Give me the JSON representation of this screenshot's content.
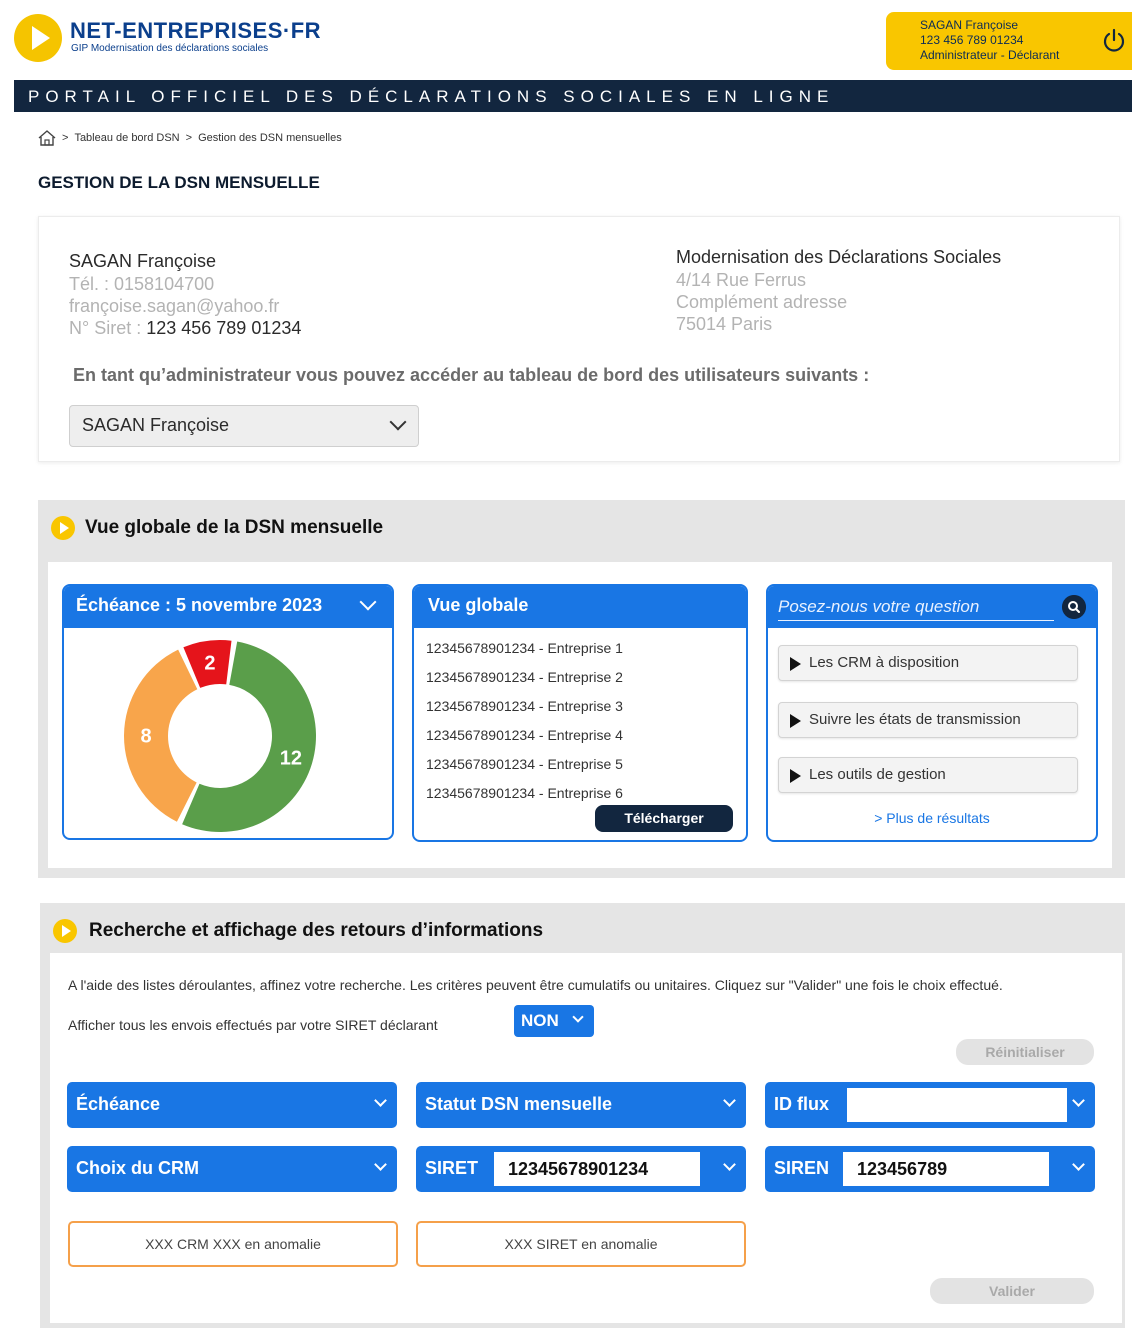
{
  "header": {
    "brand": "NET-ENTREPRISES·FR",
    "brand_sub": "GIP Modernisation des déclarations sociales",
    "user_name": "SAGAN Françoise",
    "user_siret": "123 456 789 01234",
    "user_role": "Administrateur - Déclarant",
    "logout_icon": "power-icon",
    "banner": "PORTAIL OFFICIEL DES DÉCLARATIONS SOCIALES EN LIGNE",
    "brand_color": "#0b3f8c",
    "accent_color": "#f9c600",
    "banner_color": "#12263f"
  },
  "breadcrumb": {
    "home_icon": "home-icon",
    "items": [
      "Tableau de bord DSN",
      "Gestion des DSN mensuelles"
    ],
    "separator": ">"
  },
  "page_title": "GESTION DE LA DSN MENSUELLE",
  "profile": {
    "name": "SAGAN Françoise",
    "phone": "Tél. : 0158104700",
    "email": "françoise.sagan@yahoo.fr",
    "siret_label": "N° Siret : ",
    "siret_value": "123 456 789 01234",
    "org_name": "Modernisation des Déclarations Sociales",
    "address_1": "4/14 Rue Ferrus",
    "address_2": "Complément adresse",
    "address_3": "75014 Paris",
    "admin_note": "En tant qu’administrateur vous pouvez accéder au tableau de bord des utilisateurs suivants :",
    "selected_user": "SAGAN Françoise"
  },
  "overview": {
    "title": "Vue globale de la DSN mensuelle",
    "deadline_label": "Échéance : 5 novembre 2023",
    "donut": [
      {
        "label": "12",
        "value": 12,
        "color": "#5a9e4a"
      },
      {
        "label": "8",
        "value": 8,
        "color": "#f8a54b"
      },
      {
        "label": "2",
        "value": 2,
        "color": "#e5141b"
      }
    ],
    "global_title": "Vue globale",
    "companies": [
      "12345678901234 - Entreprise 1",
      "12345678901234 - Entreprise 2",
      "12345678901234 - Entreprise 3",
      "12345678901234 - Entreprise 4",
      "12345678901234 - Entreprise 5",
      "12345678901234 - Entreprise 6"
    ],
    "download_label": "Télécharger",
    "search_placeholder": "Posez-nous votre question",
    "faq": [
      "Les CRM à disposition",
      "Suivre les états de transmission",
      "Les outils de gestion"
    ],
    "more_link": "> Plus de résultats",
    "primary_blue": "#1976e4"
  },
  "search": {
    "title": "Recherche et affichage des retours d’informations",
    "help": "A l'aide des listes déroulantes, affinez votre recherche. Les critères peuvent être cumulatifs ou unitaires. Cliquez sur \"Valider\" une fois le choix effectué.",
    "siret_toggle_label": "Afficher tous les envois effectués par votre SIRET déclarant",
    "siret_toggle_value": "NON",
    "reset_label": "Réinitialiser",
    "filters": {
      "echeance": "Échéance",
      "statut": "Statut DSN mensuelle",
      "id_flux": "ID flux",
      "id_flux_value": "",
      "crm": "Choix du CRM",
      "siret": "SIRET",
      "siret_value": "12345678901234",
      "siren": "SIREN",
      "siren_value": "123456789"
    },
    "anomaly_crm": "XXX CRM XXX en anomalie",
    "anomaly_siret": "XXX SIRET en anomalie",
    "validate_label": "Valider"
  }
}
